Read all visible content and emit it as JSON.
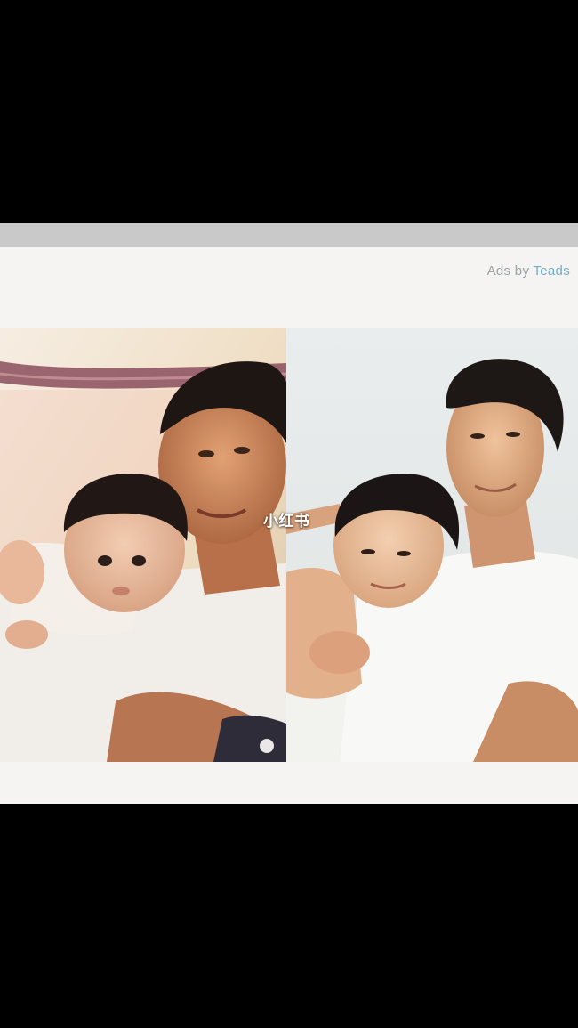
{
  "ad": {
    "prefix": "Ads by",
    "brand": "Teads"
  },
  "watermark": "小红书",
  "photos": [
    {
      "name": "left-vintage-photo",
      "description_icon": "father-and-child-photo"
    },
    {
      "name": "right-studio-photo",
      "description_icon": "father-and-son-photo"
    }
  ],
  "colors": {
    "background": "#000000",
    "card": "#f5f4f2",
    "ad_text": "#9aa3a6",
    "ad_brand": "#72aec8"
  }
}
